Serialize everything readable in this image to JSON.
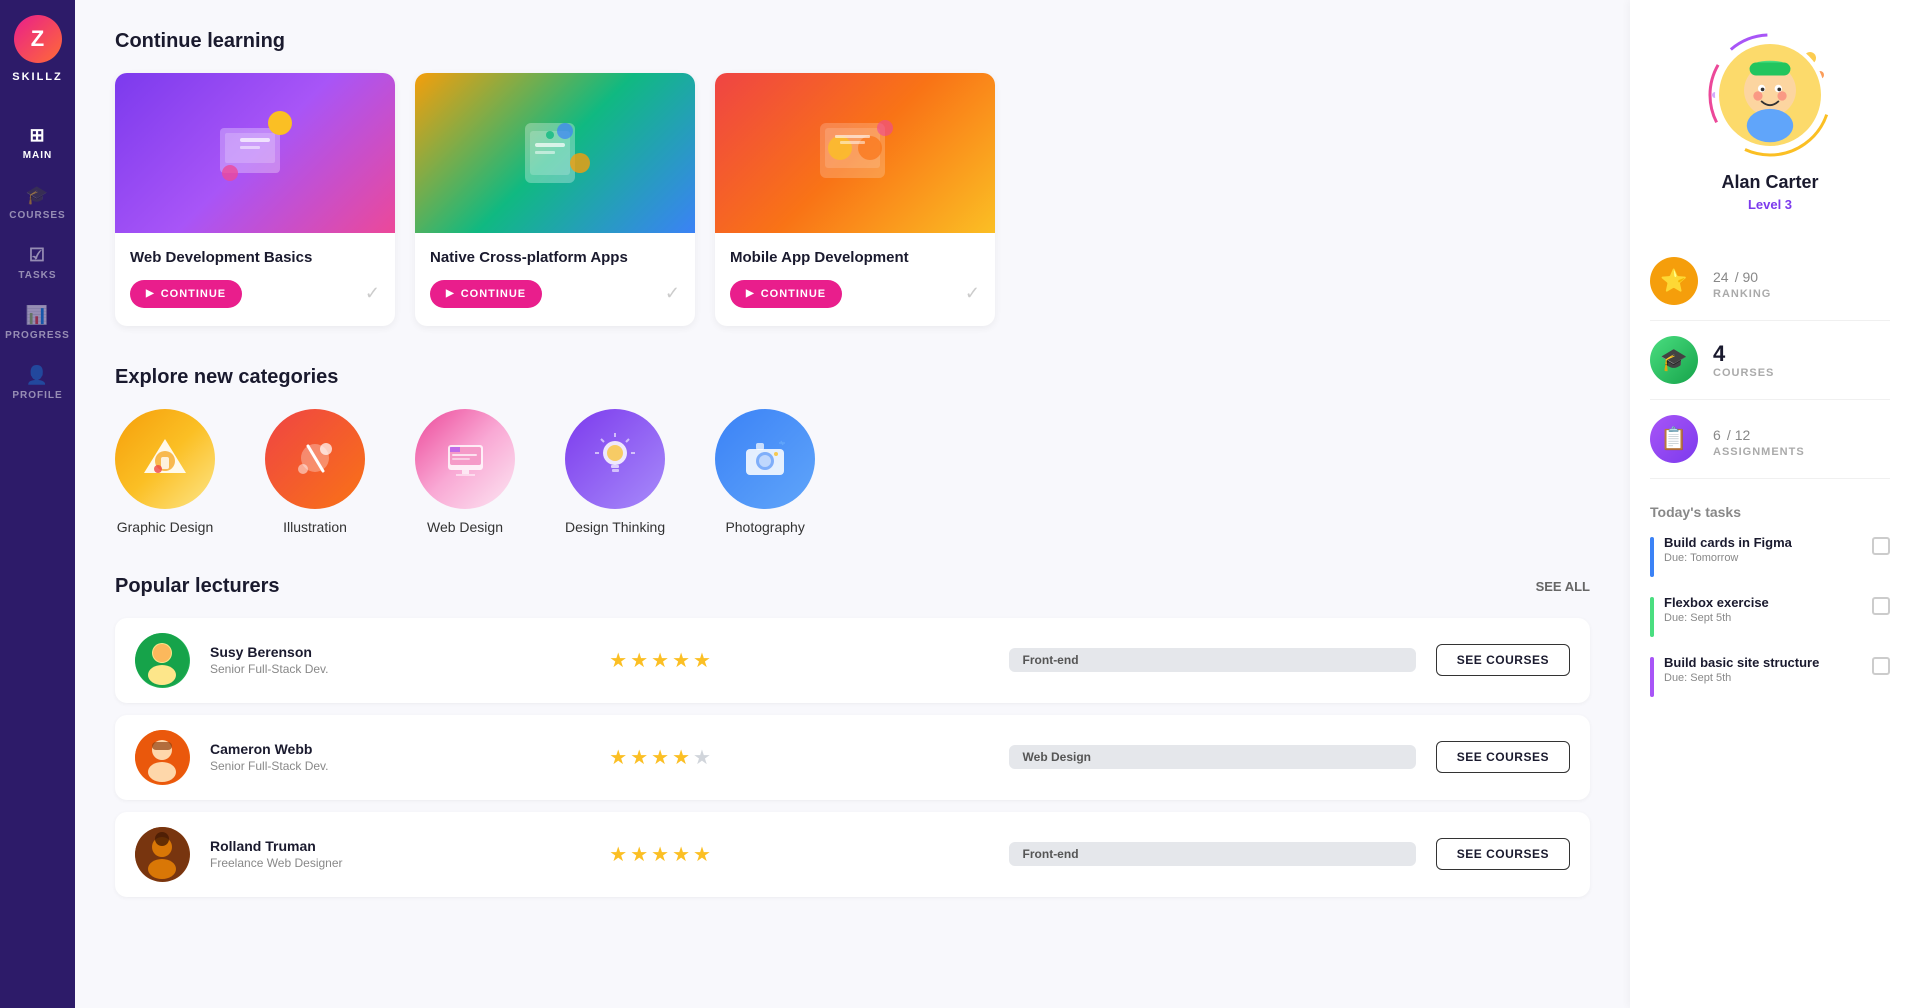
{
  "sidebar": {
    "logo_text": "Z",
    "brand": "SKILLZ",
    "items": [
      {
        "id": "main",
        "label": "MAIN",
        "icon": "⊞",
        "active": true
      },
      {
        "id": "courses",
        "label": "COURSES",
        "icon": "🎓"
      },
      {
        "id": "tasks",
        "label": "TASKS",
        "icon": "☑"
      },
      {
        "id": "progress",
        "label": "PROGRESS",
        "icon": "📊"
      },
      {
        "id": "profile",
        "label": "PROFILE",
        "icon": "👤"
      }
    ]
  },
  "main": {
    "continue_section_title": "Continue learning",
    "courses": [
      {
        "id": "web-dev",
        "title": "Web Development Basics",
        "thumb_emoji": "🖥️",
        "thumb_class": "thumb-1",
        "btn_label": "CONTINUE"
      },
      {
        "id": "native-apps",
        "title": "Native Cross-platform Apps",
        "thumb_emoji": "📱",
        "thumb_class": "thumb-2",
        "btn_label": "CONTINUE"
      },
      {
        "id": "mobile-app",
        "title": "Mobile App Development",
        "thumb_emoji": "💻",
        "thumb_class": "thumb-3",
        "btn_label": "CONTINUE"
      }
    ],
    "categories_title": "Explore new categories",
    "categories": [
      {
        "id": "graphic-design",
        "name": "Graphic Design",
        "icon": "✏️",
        "class": "cat-1"
      },
      {
        "id": "illustration",
        "name": "Illustration",
        "icon": "🎨",
        "class": "cat-2"
      },
      {
        "id": "web-design",
        "name": "Web Design",
        "icon": "🖥️",
        "class": "cat-3"
      },
      {
        "id": "design-thinking",
        "name": "Design Thinking",
        "icon": "💡",
        "class": "cat-4"
      },
      {
        "id": "photography",
        "name": "Photography",
        "icon": "📷",
        "class": "cat-5"
      }
    ],
    "lecturers_title": "Popular lecturers",
    "see_all_label": "SEE ALL",
    "lecturers": [
      {
        "id": "susy",
        "name": "Susy Berenson",
        "role": "Senior Full-Stack Dev.",
        "rating": 5,
        "tag": "Front-end",
        "avatar_class": "av-1",
        "avatar_emoji": "👩",
        "btn_label": "SEE COURSES"
      },
      {
        "id": "cameron",
        "name": "Cameron Webb",
        "role": "Senior Full-Stack Dev.",
        "rating": 4,
        "tag": "Web Design",
        "avatar_class": "av-2",
        "avatar_emoji": "👨",
        "btn_label": "SEE COURSES"
      },
      {
        "id": "rolland",
        "name": "Rolland Truman",
        "role": "Freelance Web Designer",
        "rating": 5,
        "tag": "Front-end",
        "avatar_class": "av-3",
        "avatar_emoji": "🧑",
        "btn_label": "SEE COURSES"
      }
    ]
  },
  "profile": {
    "name": "Alan Carter",
    "level": "Level 3",
    "ranking_value": "24",
    "ranking_max": "90",
    "ranking_label": "RANKING",
    "courses_count": "4",
    "courses_label": "COURSES",
    "assignments_value": "6",
    "assignments_max": "12",
    "assignments_label": "ASSIGNMENTS",
    "tasks_title": "Today's tasks",
    "tasks": [
      {
        "id": "task-1",
        "name": "Build cards in Figma",
        "due": "Due: Tomorrow",
        "bar_class": "task-bar-blue"
      },
      {
        "id": "task-2",
        "name": "Flexbox exercise",
        "due": "Due: Sept 5th",
        "bar_class": "task-bar-green"
      },
      {
        "id": "task-3",
        "name": "Build basic site structure",
        "due": "Due: Sept 5th",
        "bar_class": "task-bar-purple"
      }
    ]
  }
}
